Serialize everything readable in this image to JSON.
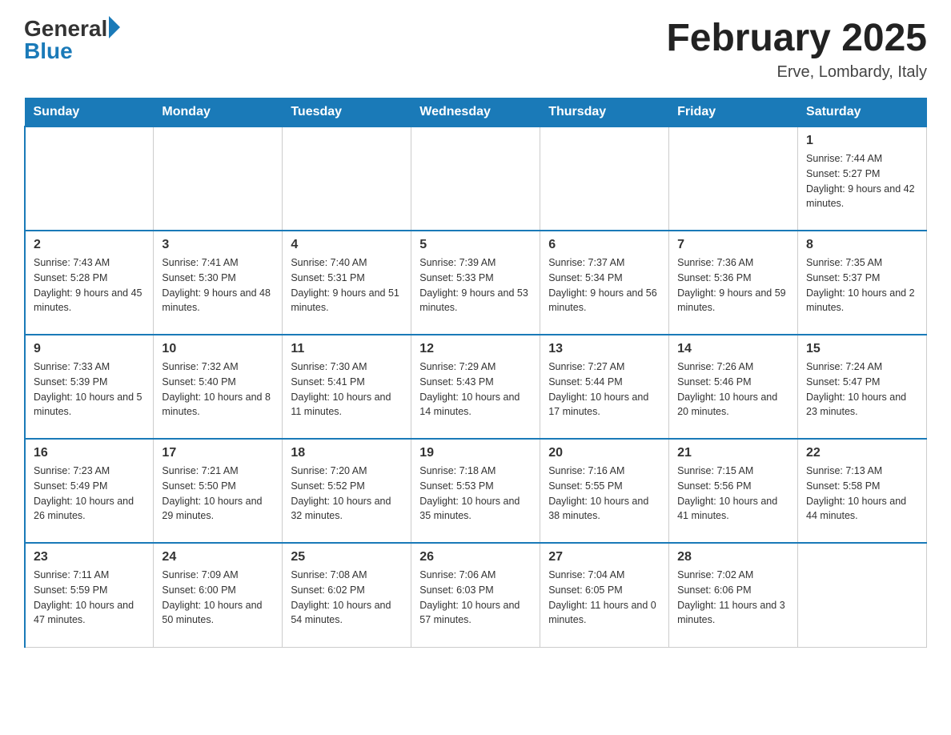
{
  "header": {
    "logo_general": "General",
    "logo_blue": "Blue",
    "month_title": "February 2025",
    "location": "Erve, Lombardy, Italy"
  },
  "days_of_week": [
    "Sunday",
    "Monday",
    "Tuesday",
    "Wednesday",
    "Thursday",
    "Friday",
    "Saturday"
  ],
  "weeks": [
    [
      {
        "day": "",
        "sunrise": "",
        "sunset": "",
        "daylight": ""
      },
      {
        "day": "",
        "sunrise": "",
        "sunset": "",
        "daylight": ""
      },
      {
        "day": "",
        "sunrise": "",
        "sunset": "",
        "daylight": ""
      },
      {
        "day": "",
        "sunrise": "",
        "sunset": "",
        "daylight": ""
      },
      {
        "day": "",
        "sunrise": "",
        "sunset": "",
        "daylight": ""
      },
      {
        "day": "",
        "sunrise": "",
        "sunset": "",
        "daylight": ""
      },
      {
        "day": "1",
        "sunrise": "Sunrise: 7:44 AM",
        "sunset": "Sunset: 5:27 PM",
        "daylight": "Daylight: 9 hours and 42 minutes."
      }
    ],
    [
      {
        "day": "2",
        "sunrise": "Sunrise: 7:43 AM",
        "sunset": "Sunset: 5:28 PM",
        "daylight": "Daylight: 9 hours and 45 minutes."
      },
      {
        "day": "3",
        "sunrise": "Sunrise: 7:41 AM",
        "sunset": "Sunset: 5:30 PM",
        "daylight": "Daylight: 9 hours and 48 minutes."
      },
      {
        "day": "4",
        "sunrise": "Sunrise: 7:40 AM",
        "sunset": "Sunset: 5:31 PM",
        "daylight": "Daylight: 9 hours and 51 minutes."
      },
      {
        "day": "5",
        "sunrise": "Sunrise: 7:39 AM",
        "sunset": "Sunset: 5:33 PM",
        "daylight": "Daylight: 9 hours and 53 minutes."
      },
      {
        "day": "6",
        "sunrise": "Sunrise: 7:37 AM",
        "sunset": "Sunset: 5:34 PM",
        "daylight": "Daylight: 9 hours and 56 minutes."
      },
      {
        "day": "7",
        "sunrise": "Sunrise: 7:36 AM",
        "sunset": "Sunset: 5:36 PM",
        "daylight": "Daylight: 9 hours and 59 minutes."
      },
      {
        "day": "8",
        "sunrise": "Sunrise: 7:35 AM",
        "sunset": "Sunset: 5:37 PM",
        "daylight": "Daylight: 10 hours and 2 minutes."
      }
    ],
    [
      {
        "day": "9",
        "sunrise": "Sunrise: 7:33 AM",
        "sunset": "Sunset: 5:39 PM",
        "daylight": "Daylight: 10 hours and 5 minutes."
      },
      {
        "day": "10",
        "sunrise": "Sunrise: 7:32 AM",
        "sunset": "Sunset: 5:40 PM",
        "daylight": "Daylight: 10 hours and 8 minutes."
      },
      {
        "day": "11",
        "sunrise": "Sunrise: 7:30 AM",
        "sunset": "Sunset: 5:41 PM",
        "daylight": "Daylight: 10 hours and 11 minutes."
      },
      {
        "day": "12",
        "sunrise": "Sunrise: 7:29 AM",
        "sunset": "Sunset: 5:43 PM",
        "daylight": "Daylight: 10 hours and 14 minutes."
      },
      {
        "day": "13",
        "sunrise": "Sunrise: 7:27 AM",
        "sunset": "Sunset: 5:44 PM",
        "daylight": "Daylight: 10 hours and 17 minutes."
      },
      {
        "day": "14",
        "sunrise": "Sunrise: 7:26 AM",
        "sunset": "Sunset: 5:46 PM",
        "daylight": "Daylight: 10 hours and 20 minutes."
      },
      {
        "day": "15",
        "sunrise": "Sunrise: 7:24 AM",
        "sunset": "Sunset: 5:47 PM",
        "daylight": "Daylight: 10 hours and 23 minutes."
      }
    ],
    [
      {
        "day": "16",
        "sunrise": "Sunrise: 7:23 AM",
        "sunset": "Sunset: 5:49 PM",
        "daylight": "Daylight: 10 hours and 26 minutes."
      },
      {
        "day": "17",
        "sunrise": "Sunrise: 7:21 AM",
        "sunset": "Sunset: 5:50 PM",
        "daylight": "Daylight: 10 hours and 29 minutes."
      },
      {
        "day": "18",
        "sunrise": "Sunrise: 7:20 AM",
        "sunset": "Sunset: 5:52 PM",
        "daylight": "Daylight: 10 hours and 32 minutes."
      },
      {
        "day": "19",
        "sunrise": "Sunrise: 7:18 AM",
        "sunset": "Sunset: 5:53 PM",
        "daylight": "Daylight: 10 hours and 35 minutes."
      },
      {
        "day": "20",
        "sunrise": "Sunrise: 7:16 AM",
        "sunset": "Sunset: 5:55 PM",
        "daylight": "Daylight: 10 hours and 38 minutes."
      },
      {
        "day": "21",
        "sunrise": "Sunrise: 7:15 AM",
        "sunset": "Sunset: 5:56 PM",
        "daylight": "Daylight: 10 hours and 41 minutes."
      },
      {
        "day": "22",
        "sunrise": "Sunrise: 7:13 AM",
        "sunset": "Sunset: 5:58 PM",
        "daylight": "Daylight: 10 hours and 44 minutes."
      }
    ],
    [
      {
        "day": "23",
        "sunrise": "Sunrise: 7:11 AM",
        "sunset": "Sunset: 5:59 PM",
        "daylight": "Daylight: 10 hours and 47 minutes."
      },
      {
        "day": "24",
        "sunrise": "Sunrise: 7:09 AM",
        "sunset": "Sunset: 6:00 PM",
        "daylight": "Daylight: 10 hours and 50 minutes."
      },
      {
        "day": "25",
        "sunrise": "Sunrise: 7:08 AM",
        "sunset": "Sunset: 6:02 PM",
        "daylight": "Daylight: 10 hours and 54 minutes."
      },
      {
        "day": "26",
        "sunrise": "Sunrise: 7:06 AM",
        "sunset": "Sunset: 6:03 PM",
        "daylight": "Daylight: 10 hours and 57 minutes."
      },
      {
        "day": "27",
        "sunrise": "Sunrise: 7:04 AM",
        "sunset": "Sunset: 6:05 PM",
        "daylight": "Daylight: 11 hours and 0 minutes."
      },
      {
        "day": "28",
        "sunrise": "Sunrise: 7:02 AM",
        "sunset": "Sunset: 6:06 PM",
        "daylight": "Daylight: 11 hours and 3 minutes."
      },
      {
        "day": "",
        "sunrise": "",
        "sunset": "",
        "daylight": ""
      }
    ]
  ]
}
